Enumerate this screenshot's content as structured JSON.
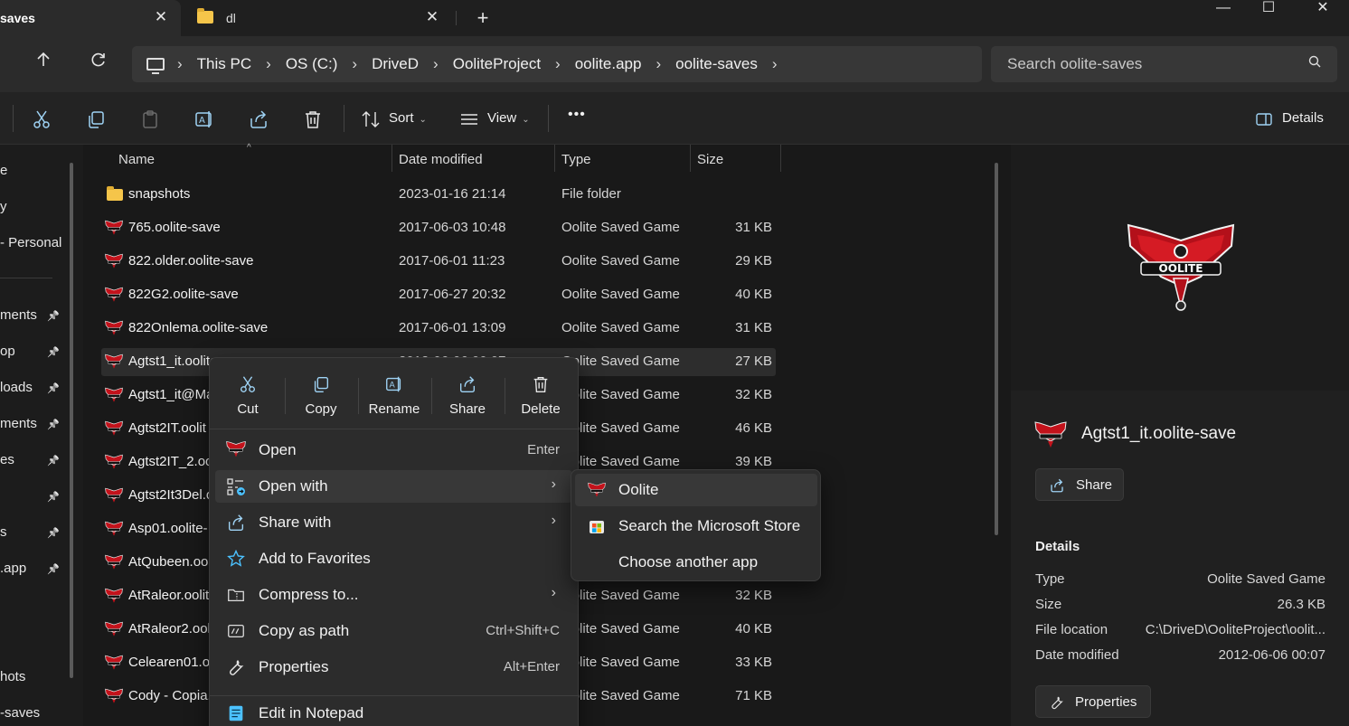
{
  "tabs": {
    "active_label": "saves",
    "inactive_label": "dl"
  },
  "breadcrumb": [
    "This PC",
    "OS (C:)",
    "DriveD",
    "OoliteProject",
    "oolite.app",
    "oolite-saves"
  ],
  "search": {
    "placeholder": "Search oolite-saves"
  },
  "toolbar": {
    "sort_label": "Sort",
    "view_label": "View",
    "details_label": "Details",
    "more_label": "•••"
  },
  "leftnav": {
    "items": [
      {
        "label": "e",
        "pinned": false
      },
      {
        "label": "y",
        "pinned": false
      },
      {
        "label": " - Personal",
        "pinned": false
      },
      {
        "label": "ments",
        "pinned": true
      },
      {
        "label": "op",
        "pinned": true
      },
      {
        "label": "loads",
        "pinned": true
      },
      {
        "label": "ments",
        "pinned": true
      },
      {
        "label": "es",
        "pinned": true
      },
      {
        "label": "",
        "pinned": true
      },
      {
        "label": "s",
        "pinned": true
      },
      {
        "label": ".app",
        "pinned": true
      },
      {
        "label": "hots",
        "pinned": false
      },
      {
        "label": "-saves",
        "pinned": false
      }
    ]
  },
  "columns": {
    "name": "Name",
    "date": "Date modified",
    "type": "Type",
    "size": "Size"
  },
  "files": [
    {
      "name": "snapshots",
      "date": "2023-01-16 21:14",
      "type": "File folder",
      "size": "",
      "kind": "folder"
    },
    {
      "name": "765.oolite-save",
      "date": "2017-06-03 10:48",
      "type": "Oolite Saved Game",
      "size": "31 KB",
      "kind": "save"
    },
    {
      "name": "822.older.oolite-save",
      "date": "2017-06-01 11:23",
      "type": "Oolite Saved Game",
      "size": "29 KB",
      "kind": "save"
    },
    {
      "name": "822G2.oolite-save",
      "date": "2017-06-27 20:32",
      "type": "Oolite Saved Game",
      "size": "40 KB",
      "kind": "save"
    },
    {
      "name": "822Onlema.oolite-save",
      "date": "2017-06-01 13:09",
      "type": "Oolite Saved Game",
      "size": "31 KB",
      "kind": "save"
    },
    {
      "name": "Agtst1_it.oolite-save",
      "date": "2012-06-06 00:07",
      "type": "Oolite Saved Game",
      "size": "27 KB",
      "kind": "save",
      "selected": true
    },
    {
      "name": "Agtst1_it@Ma",
      "date": "",
      "type": "Oolite Saved Game",
      "size": "32 KB",
      "kind": "save"
    },
    {
      "name": "Agtst2IT.oolit",
      "date": "",
      "type": "Oolite Saved Game",
      "size": "46 KB",
      "kind": "save"
    },
    {
      "name": "Agtst2IT_2.oo",
      "date": "",
      "type": "Oolite Saved Game",
      "size": "39 KB",
      "kind": "save"
    },
    {
      "name": "Agtst2It3Del.o",
      "date": "",
      "type": "",
      "size": "",
      "kind": "save"
    },
    {
      "name": "Asp01.oolite-",
      "date": "",
      "type": "",
      "size": "",
      "kind": "save"
    },
    {
      "name": "AtQubeen.oo",
      "date": "",
      "type": "",
      "size": "",
      "kind": "save"
    },
    {
      "name": "AtRaleor.oolit",
      "date": "",
      "type": "Oolite Saved Game",
      "size": "32 KB",
      "kind": "save"
    },
    {
      "name": "AtRaleor2.ool",
      "date": "",
      "type": "Oolite Saved Game",
      "size": "40 KB",
      "kind": "save"
    },
    {
      "name": "Celearen01.oo",
      "date": "",
      "type": "Oolite Saved Game",
      "size": "33 KB",
      "kind": "save"
    },
    {
      "name": "Cody - Copia.",
      "date": "",
      "type": "Oolite Saved Game",
      "size": "71 KB",
      "kind": "save"
    }
  ],
  "context_menu": {
    "quick_actions": [
      "Cut",
      "Copy",
      "Rename",
      "Share",
      "Delete"
    ],
    "items": [
      {
        "label": "Open",
        "shortcut": "Enter",
        "icon": "oolite-icon",
        "submenu": false
      },
      {
        "label": "Open with",
        "shortcut": "",
        "icon": "open-with-icon",
        "submenu": true
      },
      {
        "label": "Share with",
        "shortcut": "",
        "icon": "share-with-icon",
        "submenu": true
      },
      {
        "label": "Add to Favorites",
        "shortcut": "",
        "icon": "star-icon",
        "submenu": false
      },
      {
        "label": "Compress to...",
        "shortcut": "",
        "icon": "compress-icon",
        "submenu": true
      },
      {
        "label": "Copy as path",
        "shortcut": "Ctrl+Shift+C",
        "icon": "copy-path-icon",
        "submenu": false
      },
      {
        "label": "Properties",
        "shortcut": "Alt+Enter",
        "icon": "wrench-icon",
        "submenu": false
      },
      {
        "label": "Edit in Notepad",
        "shortcut": "",
        "icon": "notepad-icon",
        "submenu": false
      }
    ]
  },
  "open_with_submenu": [
    "Oolite",
    "Search the Microsoft Store",
    "Choose another app"
  ],
  "details_pane": {
    "logo_text": "OOLITE",
    "file_name": "Agtst1_it.oolite-save",
    "share_label": "Share",
    "section_title": "Details",
    "fields": [
      {
        "label": "Type",
        "value": "Oolite Saved Game"
      },
      {
        "label": "Size",
        "value": "26.3 KB"
      },
      {
        "label": "File location",
        "value": "C:\\DriveD\\OoliteProject\\oolit..."
      },
      {
        "label": "Date modified",
        "value": "2012-06-06 00:07"
      }
    ],
    "properties_label": "Properties"
  },
  "colors": {
    "accent": "#4cc2ff",
    "oolite_red": "#c3121b",
    "folder": "#f5c54a"
  }
}
